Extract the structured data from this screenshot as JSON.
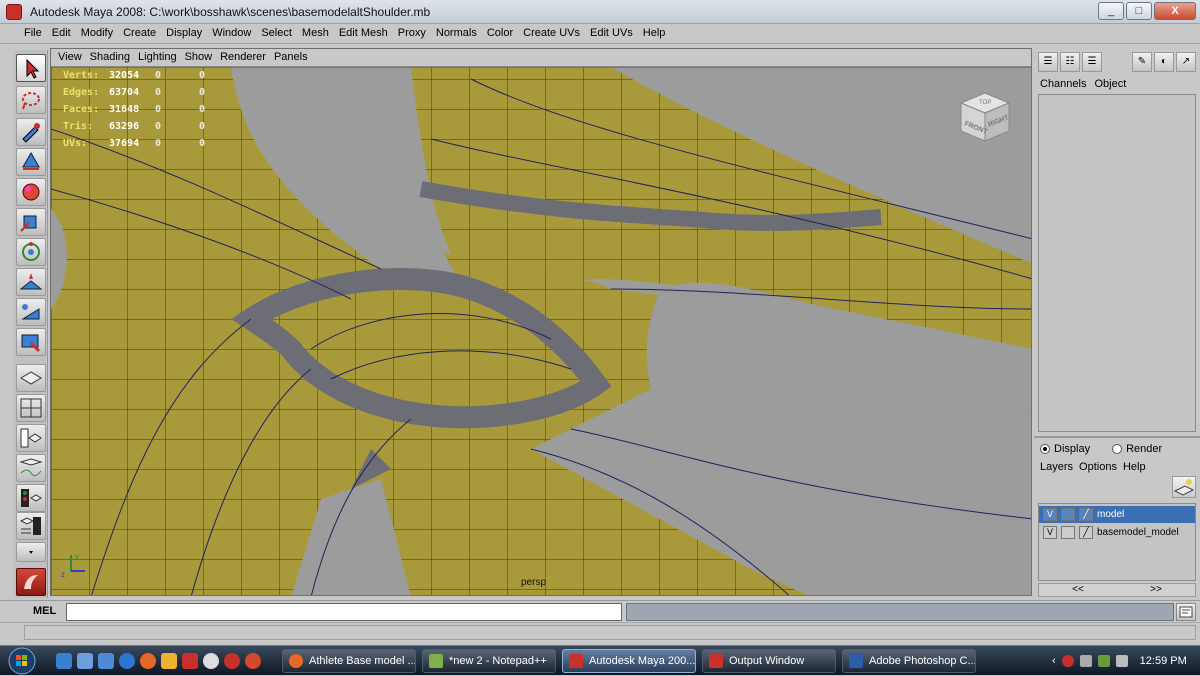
{
  "window": {
    "title": "Autodesk Maya 2008: C:\\work\\bosshawk\\scenes\\basemodelaltShoulder.mb",
    "minimize": "_",
    "maximize": "□",
    "close": "X"
  },
  "menubar": [
    "File",
    "Edit",
    "Modify",
    "Create",
    "Display",
    "Window",
    "Select",
    "Mesh",
    "Edit Mesh",
    "Proxy",
    "Normals",
    "Color",
    "Create UVs",
    "Edit UVs",
    "Help"
  ],
  "panel_menu": [
    "View",
    "Shading",
    "Lighting",
    "Show",
    "Renderer",
    "Panels"
  ],
  "hud": [
    {
      "label": "Verts:",
      "v1": "32054",
      "v2": "0",
      "v3": "0"
    },
    {
      "label": "Edges:",
      "v1": "63704",
      "v2": "0",
      "v3": "0"
    },
    {
      "label": "Faces:",
      "v1": "31648",
      "v2": "0",
      "v3": "0"
    },
    {
      "label": "Tris:",
      "v1": "63296",
      "v2": "0",
      "v3": "0"
    },
    {
      "label": "UVs:",
      "v1": "37694",
      "v2": "0",
      "v3": "0"
    }
  ],
  "viewport": {
    "camera": "persp",
    "viewcube": {
      "top": "TOP",
      "front": "FRONT",
      "right": "RIGHT"
    },
    "axis_y": "y",
    "axis_z": "z",
    "surface_color": "#a89a3a",
    "background_color": "#9c9c9c"
  },
  "channel_box": {
    "tabs": [
      "Channels",
      "Object"
    ]
  },
  "layer_editor": {
    "display_label": "Display",
    "render_label": "Render",
    "menu": [
      "Layers",
      "Options",
      "Help"
    ],
    "layers": [
      {
        "visible": "V",
        "name": "model",
        "selected": true
      },
      {
        "visible": "V",
        "name": "basemodel_model",
        "selected": false
      }
    ],
    "scroll_left": "<<",
    "scroll_right": ">>"
  },
  "command_line": {
    "label": "MEL",
    "value": ""
  },
  "taskbar": {
    "tasks": [
      {
        "label": "Athlete Base model ...",
        "color": "#e8682a"
      },
      {
        "label": "*new  2 - Notepad++",
        "color": "#7fb24a"
      },
      {
        "label": "Autodesk Maya 200...",
        "color": "#c9302c",
        "active": true
      },
      {
        "label": "Output Window",
        "color": "#c9302c"
      },
      {
        "label": "Adobe Photoshop C...",
        "color": "#2b5ea8"
      }
    ],
    "clock": "12:59 PM"
  }
}
